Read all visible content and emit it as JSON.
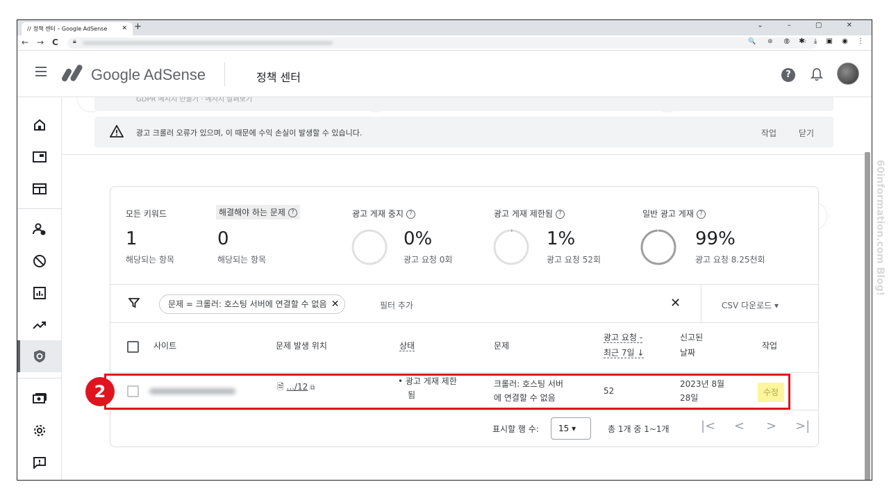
{
  "browser": {
    "tab_title": "정책 센터 – Google AdSense",
    "new_tab": "+",
    "window_controls": "⌄ – ▢ ✕",
    "nav_back": "←",
    "nav_forward": "→",
    "nav_reload": "C",
    "url_icons": "🔍 ⊕ ⇪ ☆",
    "extension_icons": "◎ ✱ ⤓ ▣ ◉ ⋮"
  },
  "header": {
    "brand": "Google AdSense",
    "page_name": "정책 센터"
  },
  "rail": {
    "items": [
      "home-icon",
      "ads-icon",
      "sites-icon",
      "account-icon",
      "block-icon",
      "reports-icon",
      "optimize-icon",
      "policy-center-icon",
      "payments-icon",
      "settings-icon",
      "feedback-icon"
    ]
  },
  "banners": {
    "clipped_text": "GDPR 메시지 만들기 · 메시지 살펴보기",
    "alert_text": "광고 크롤러 오류가 있으며, 이 때문에 수익 손실이 발생할 수 있습니다.",
    "alert_action": "작업",
    "alert_close": "닫기"
  },
  "stats": {
    "all_keywords": {
      "label": "모든 키워드",
      "value": "1",
      "sub": "해당되는 항목"
    },
    "must_fix": {
      "label": "해결해야 하는 문제",
      "value": "0",
      "sub": "해당되는 항목"
    },
    "ads_stopped": {
      "label": "광고 게재 중지",
      "value": "0%",
      "sub": "광고 요청 0회",
      "fraction": 0.0
    },
    "ads_restricted": {
      "label": "광고 게재 제한됨",
      "value": "1%",
      "sub": "광고 요청 52회",
      "fraction": 0.01
    },
    "ads_normal": {
      "label": "일반 광고 게재",
      "value": "99%",
      "sub": "광고 요청 8.25천회",
      "fraction": 0.99
    },
    "help_glyph": "?"
  },
  "filter": {
    "chip": "문제 = 크롤러: 호스팅 서버에 연결할 수 없음",
    "chip_close": "✕",
    "add_filter": "필터 추가",
    "clear": "✕",
    "csv": "CSV 다운로드 ▾"
  },
  "table": {
    "headers": {
      "site": "사이트",
      "location": "문제 발생 위치",
      "status": "상태",
      "issue": "문제",
      "requests_line1": "광고 요청 -",
      "requests_line2": "최근 7일 ↓",
      "reported_line1": "신고된",
      "reported_line2": "날짜",
      "action": "작업"
    },
    "rows": [
      {
        "location": ".../12",
        "status_line1": "• 광고 게재 제한",
        "status_line2": "됨",
        "issue_line1": "크롤러: 호스팅 서버",
        "issue_line2": "에 연결할 수 없음",
        "requests": "52",
        "date_line1": "2023년 8월",
        "date_line2": "28일",
        "action": "수정"
      }
    ]
  },
  "pager": {
    "rows_label": "표시할 행 수:",
    "rows_value": "15 ▾",
    "range": "총 1개 중 1~1개",
    "first": "|<",
    "prev": "<",
    "next": ">",
    "last": ">|"
  },
  "annotation": {
    "step": "2"
  },
  "watermark": "60information.com  Blog!",
  "colors": {
    "highlight": "#e0141e",
    "edit_highlight": "#fff59d",
    "ring_active": "#9e9e9e",
    "ring_track": "#e0e0e0"
  }
}
